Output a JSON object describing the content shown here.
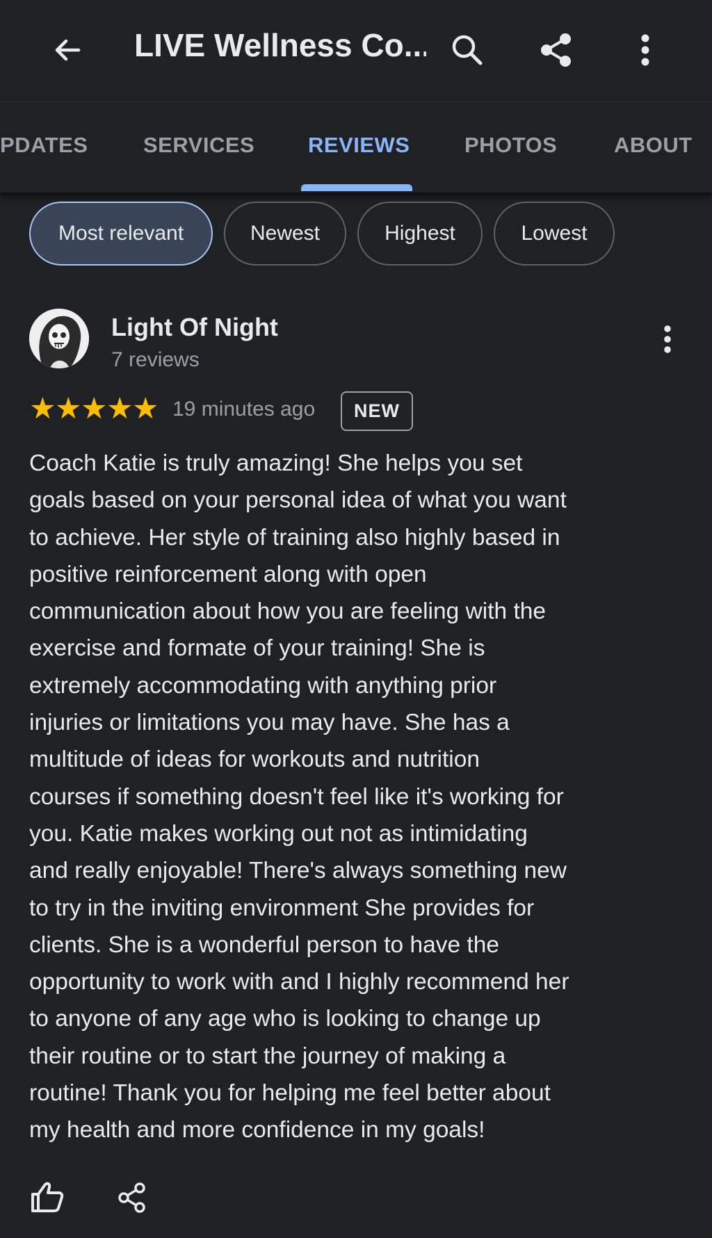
{
  "app_bar": {
    "title": "LIVE Wellness Co...",
    "back_icon": "arrow-left-icon",
    "search_icon": "search-icon",
    "share_icon": "share-icon",
    "more_icon": "more-vert-icon"
  },
  "tabs": [
    {
      "label": "PDATES",
      "active": false
    },
    {
      "label": "SERVICES",
      "active": false
    },
    {
      "label": "REVIEWS",
      "active": true
    },
    {
      "label": "PHOTOS",
      "active": false
    },
    {
      "label": "ABOUT",
      "active": false
    }
  ],
  "sort_chips": [
    {
      "label": "Most relevant",
      "selected": true
    },
    {
      "label": "Newest",
      "selected": false
    },
    {
      "label": "Highest",
      "selected": false
    },
    {
      "label": "Lowest",
      "selected": false
    }
  ],
  "review": {
    "reviewer_name": "Light Of Night",
    "reviewer_review_count": "7 reviews",
    "rating": 5,
    "max_rating": 5,
    "time": "19 minutes ago",
    "badge": "NEW",
    "text_lines": [
      "Coach Katie is truly amazing! She helps you set",
      "goals based on your personal idea of what you want",
      "to achieve. Her style of training also highly based in",
      "positive reinforcement along with open",
      "communication about how you are feeling with the",
      "exercise and formate of your training! She is",
      "extremely accommodating with anything prior",
      "injuries or limitations you may have. She has a",
      "multitude of ideas for workouts and nutrition",
      "courses if something doesn't feel like it's working for",
      "you. Katie makes working out not as intimidating",
      "and really enjoyable! There's always something new",
      "to try in the inviting environment She provides for",
      "clients. She is a wonderful person to have the",
      "opportunity to work with and I highly recommend her",
      "to anyone of any age who is looking to change up",
      "their routine or to start the journey of making a",
      "routine! Thank you for helping me feel better about",
      "my health and more confidence in my goals!"
    ],
    "actions": {
      "like_icon": "thumbs-up-icon",
      "share_icon": "share-icon"
    }
  },
  "colors": {
    "background": "#202124",
    "accent": "#8ab4f8",
    "star": "#fbbc04",
    "selected_chip": "#394457"
  }
}
